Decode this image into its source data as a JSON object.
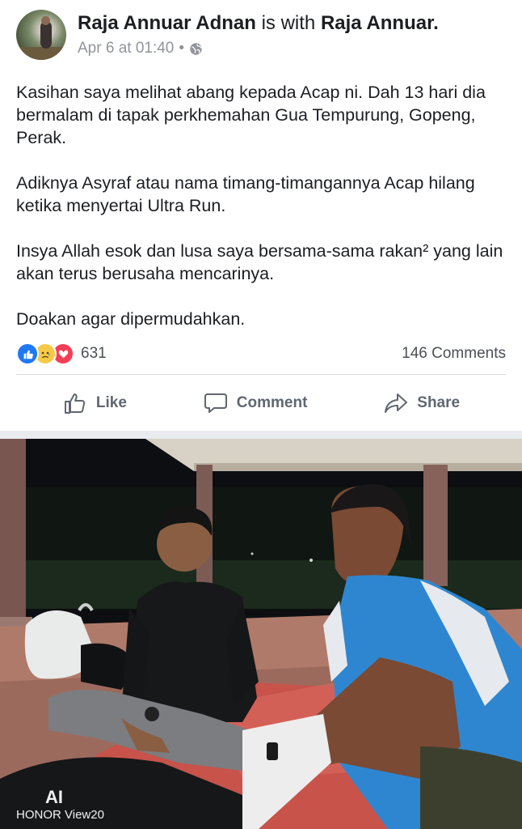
{
  "post": {
    "author": "Raja Annuar Adnan",
    "with_text": "is with",
    "tagged": "Raja Annuar.",
    "timestamp": "Apr 6 at 01:40",
    "separator": "•",
    "privacy_icon": "globe-icon",
    "paragraphs": [
      "Kasihan saya melihat abang kepada Acap ni. Dah 13 hari dia bermalam di tapak perkhemahan Gua Tempurung, Gopeng, Perak.",
      "Adiknya Asyraf atau nama timang-timangannya Acap hilang ketika menyertai Ultra Run.",
      "Insya Allah esok dan lusa saya bersama-sama rakan² yang lain akan terus berusaha mencarinya.",
      "Doakan agar dipermudahkan."
    ]
  },
  "reactions": {
    "icons": [
      "like-icon",
      "sad-icon",
      "love-icon"
    ],
    "count": "631",
    "comments": "146 Comments"
  },
  "actions": {
    "like": "Like",
    "comment": "Comment",
    "share": "Share"
  },
  "photo": {
    "watermark_logo": "AI",
    "watermark_text": "HONOR View20"
  },
  "colors": {
    "like_blue": "#2078f4",
    "love_red": "#f33e58",
    "sad_yellow": "#f7c948",
    "meta_gray": "#90949c"
  }
}
